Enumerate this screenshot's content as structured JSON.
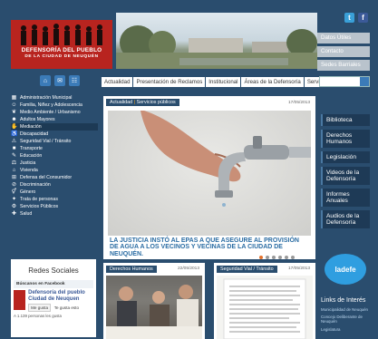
{
  "logo": {
    "line1": "DEFENSORÍA DEL PUEBLO",
    "line2": "DE LA CIUDAD DE NEUQUÉN"
  },
  "social": {
    "twitter": "t",
    "facebook": "f"
  },
  "side_links": [
    "Datos Útiles",
    "Contacto",
    "Sedes Barriales"
  ],
  "nav": {
    "tabs": [
      "Actualidad",
      "Presentación de Reclamos",
      "Institucional",
      "Áreas de la Defensoría",
      "Servicios"
    ]
  },
  "icons": {
    "home": "home-icon",
    "mail": "mail-icon",
    "sitemap": "sitemap-icon"
  },
  "left_menu": [
    "Administración Municipal",
    "Familia, Niñez y Adolescencia",
    "Medio Ambiente / Urbanismo",
    "Adultos Mayores",
    "Mediación",
    "Discapacidad",
    "Seguridad Vial / Tránsito",
    "Transporte",
    "Educación",
    "Justicia",
    "Vivienda",
    "Defensa del Consumidor",
    "Discriminación",
    "Género",
    "Trata de personas",
    "Servicios Públicos",
    "Salud"
  ],
  "social_box": {
    "title": "Redes Sociales",
    "subtitle": "Búscanos en Facebook",
    "fb_name": "Defensoría del pueblo Ciudad de Neuquen",
    "like_button": "Me gusta",
    "like_text": "Te gusta esto",
    "count_text": "A 1.139 personas les gusta"
  },
  "main_slide": {
    "category": "Actualidad",
    "subcategory": "Servicios públicos",
    "date": "17/05/2013",
    "headline": "LA JUSTICIA INSTÓ AL EPAS A QUE ASEGURE AL PROVISIÓN DE AGUA A LOS VECINOS Y VECINAS DE LA CIUDAD DE NEUQUÉN."
  },
  "news": [
    {
      "category": "Derechos Humanos",
      "date": "22/05/2013"
    },
    {
      "category": "Seguridad Vial / Tránsito",
      "date": "17/05/2013"
    }
  ],
  "right_menu": [
    "Biblioteca",
    "Derechos Humanos",
    "Legislación",
    "Videos de la Defensoría",
    "Informes Anuales",
    "Audios de la Defensoría"
  ],
  "ladefe": "ladefe",
  "links": {
    "title": "Links de Interés",
    "items": [
      "Municipalidad de Neuquén",
      "Concejo Deliberante de Neuquén",
      "Legislatura"
    ]
  }
}
